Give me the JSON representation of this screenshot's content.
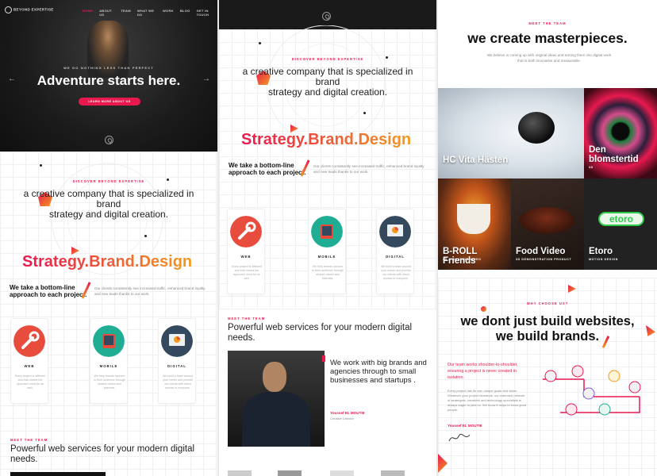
{
  "logo": {
    "text": "BEYOND EXPERTISE"
  },
  "nav": {
    "items": [
      "HOME",
      "ABOUT US",
      "TEAM",
      "WHAT WE DO",
      "WORK",
      "BLOG",
      "GET IN TOUCH"
    ]
  },
  "hero": {
    "kicker": "WE DO NOTHING LESS THAN PERFECT",
    "title": "Adventure starts here.",
    "cta": "LEARN MORE ABOUT US"
  },
  "intro": {
    "kicker": "DISCOVER BEYOND EXPERTISE",
    "lead1": "a creative company that is specialized in",
    "lead2": "brand",
    "lead3": "strategy and digital creation.",
    "tagline": "Strategy.Brand.Design"
  },
  "approach": {
    "title": "We take a bottom-line approach to each project.",
    "text": "Our clients consistently see increased traffic, enhanced brand loyalty and new leads thanks to our work."
  },
  "services": [
    {
      "label": "WEB",
      "text": "Every project is different and that means the approach must be as well."
    },
    {
      "label": "MOBILE",
      "text": "We help brands connect to their audience through shared values and interests."
    },
    {
      "label": "DIGITAL",
      "text": "We build a team around your needs and provide our clients with direct access to everyone."
    }
  ],
  "team": {
    "kicker": "MEET THE TEAM",
    "title": "Powerful web services for your modern digital needs.",
    "quote": "We work with big brands and agencies through to small businesses and startups .",
    "name": "Youssef EL MOUTIE",
    "role": "Creative Director"
  },
  "masterpieces": {
    "kicker": "MEET THE TEAM",
    "title": "we create masterpieces.",
    "text": "We believe in coming up with original ideas and turning them into digital work that is both innovative and measurable."
  },
  "portfolio": [
    {
      "title": "HC Vita Hästen",
      "subtitle": ""
    },
    {
      "title": "Den blomstertid",
      "subtitle": "3D"
    },
    {
      "title": "B-ROLL Friends",
      "subtitle": "3D ANIMATION VIDEO"
    },
    {
      "title": "Food Video",
      "subtitle": "3D DEMONSTRATION PRODUCT"
    },
    {
      "title": "Etoro",
      "subtitle": "MOTION DESIGN"
    }
  ],
  "etoro_logo": "etoro",
  "why": {
    "kicker": "WHY CHOOSE US?",
    "title1": "we dont just build websites,",
    "title2": "we build brands.",
    "red": "Our team works shoulder-to-shoulder, ensuring a project is never created in isolation.",
    "text": "Every project has its own unique goals and vision. Whatever your project demands, our extended network of strategists, creatives and technology specialists is always eager to pitch in. We know it helps to know good people.",
    "name": "Youssef EL MOUTIE"
  },
  "colors": {
    "accent": "#e8194f",
    "orange": "#f49a1f"
  }
}
